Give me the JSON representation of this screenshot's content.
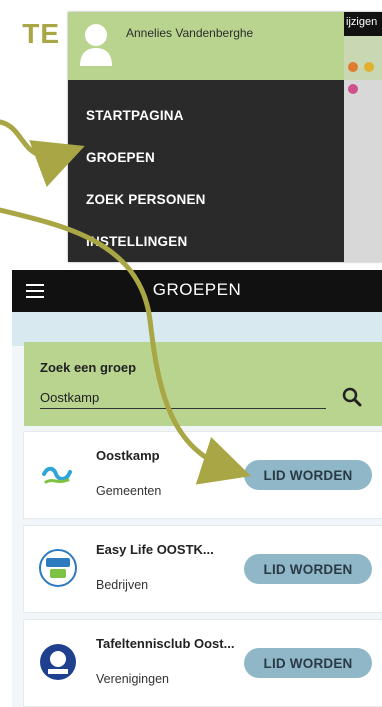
{
  "fragment_title": "TE",
  "menu_screenshot": {
    "user_name": "Annelies Vandenberghe",
    "bg_text": "ijzigen",
    "nav": [
      "STARTPAGINA",
      "GROEPEN",
      "ZOEK PERSONEN",
      "INSTELLINGEN"
    ],
    "colors": {
      "header": "#b8d48f",
      "drawer": "#2a2a2a"
    }
  },
  "groups_screenshot": {
    "title": "GROEPEN",
    "search": {
      "label": "Zoek een groep",
      "value": "Oostkamp"
    },
    "groups": [
      {
        "name": "Oostkamp",
        "category": "Gemeenten",
        "action": "LID WORDEN",
        "logo": "oostkamp-logo"
      },
      {
        "name": "Easy Life OOSTK...",
        "category": "Bedrijven",
        "action": "LID WORDEN",
        "logo": "easy-life-logo"
      },
      {
        "name": "Tafeltennisclub Oost...",
        "category": "Verenigingen",
        "action": "LID WORDEN",
        "logo": "tafeltennis-logo"
      }
    ],
    "colors": {
      "accent": "#a9a645",
      "button": "#8fb7c8"
    }
  }
}
